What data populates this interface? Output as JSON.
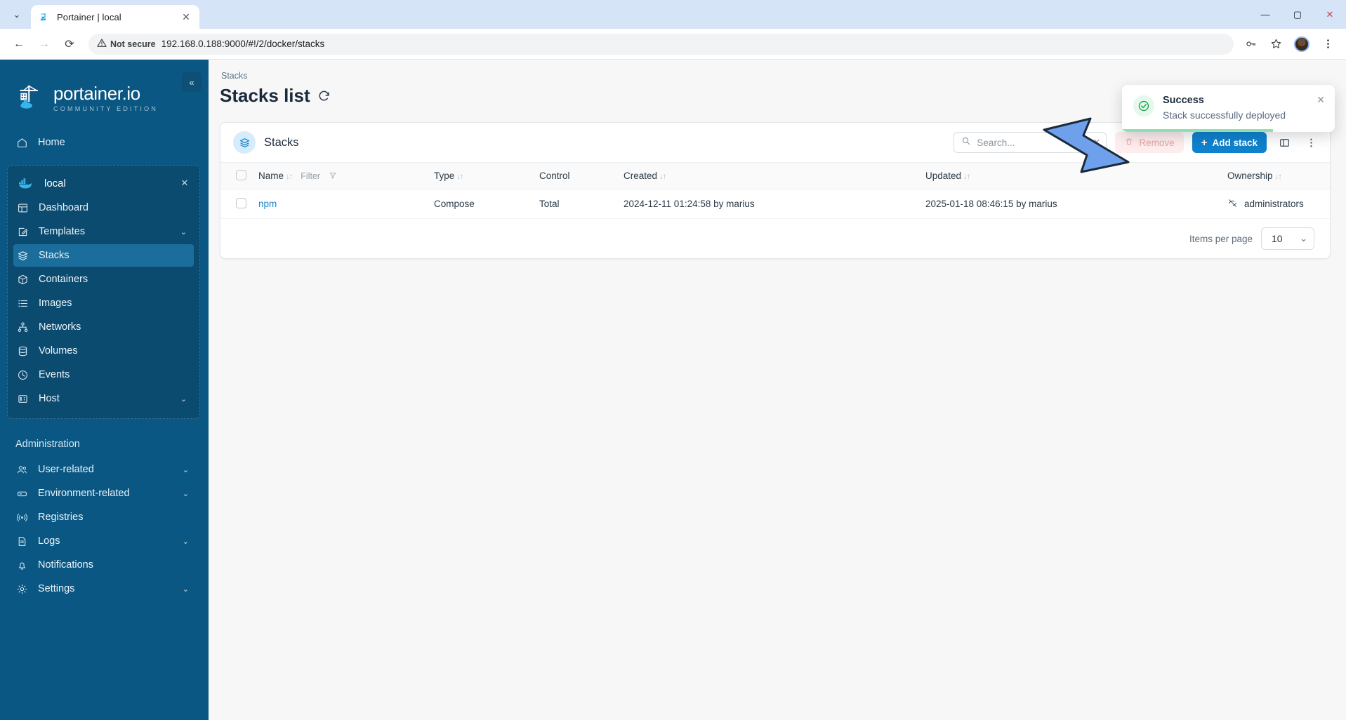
{
  "browser": {
    "tab_title": "Portainer | local",
    "tab_close": "✕",
    "tab_list_arrow": "⌄",
    "favicon": "portainer-favicon",
    "back": "←",
    "forward": "→",
    "reload": "⟳",
    "security_label": "Not secure",
    "url": "192.168.0.188:9000/#!/2/docker/stacks",
    "minimize": "—",
    "maximize": "▢",
    "close": "✕"
  },
  "sidebar": {
    "collapse_icon": "«",
    "logo_title": "portainer.io",
    "logo_subtitle": "COMMUNITY EDITION",
    "home": {
      "label": "Home",
      "icon": "home-icon"
    },
    "environment": {
      "name": "local",
      "close_icon": "✕",
      "items": [
        {
          "label": "Dashboard",
          "icon": "dashboard-icon",
          "chevron": "",
          "active": false
        },
        {
          "label": "Templates",
          "icon": "templates-icon",
          "chevron": "⌄",
          "active": false
        },
        {
          "label": "Stacks",
          "icon": "stacks-icon",
          "chevron": "",
          "active": true
        },
        {
          "label": "Containers",
          "icon": "containers-icon",
          "chevron": "",
          "active": false
        },
        {
          "label": "Images",
          "icon": "images-icon",
          "chevron": "",
          "active": false
        },
        {
          "label": "Networks",
          "icon": "networks-icon",
          "chevron": "",
          "active": false
        },
        {
          "label": "Volumes",
          "icon": "volumes-icon",
          "chevron": "",
          "active": false
        },
        {
          "label": "Events",
          "icon": "events-icon",
          "chevron": "",
          "active": false
        },
        {
          "label": "Host",
          "icon": "host-icon",
          "chevron": "⌄",
          "active": false
        }
      ]
    },
    "administration_title": "Administration",
    "admin_items": [
      {
        "label": "User-related",
        "icon": "users-icon",
        "chevron": "⌄"
      },
      {
        "label": "Environment-related",
        "icon": "environment-icon",
        "chevron": "⌄"
      },
      {
        "label": "Registries",
        "icon": "registries-icon",
        "chevron": ""
      },
      {
        "label": "Logs",
        "icon": "logs-icon",
        "chevron": "⌄"
      },
      {
        "label": "Notifications",
        "icon": "bell-icon",
        "chevron": ""
      },
      {
        "label": "Settings",
        "icon": "gear-icon",
        "chevron": "⌄"
      }
    ]
  },
  "main": {
    "breadcrumb": "Stacks",
    "page_title": "Stacks list",
    "card_title": "Stacks",
    "search_placeholder": "Search...",
    "search_value": "",
    "search_clear": "✕",
    "remove_label": "Remove",
    "add_stack_label": "Add stack",
    "add_stack_plus": "+",
    "columns_icon": "columns-icon",
    "more_icon": "more-vertical-icon",
    "table": {
      "headers": [
        {
          "label": "Name",
          "sortable": true,
          "filter": "Filter"
        },
        {
          "label": "Type",
          "sortable": true
        },
        {
          "label": "Control",
          "sortable": false
        },
        {
          "label": "Created",
          "sortable": true
        },
        {
          "label": "Updated",
          "sortable": true
        },
        {
          "label": "Ownership",
          "sortable": true
        }
      ],
      "sort_glyph": "↓↑",
      "rows": [
        {
          "name": "npm",
          "type": "Compose",
          "control": "Total",
          "created": "2024-12-11 01:24:58 by marius",
          "updated": "2025-01-18 08:46:15 by marius",
          "ownership": "administrators",
          "ownership_icon": "eye-off-icon"
        }
      ]
    },
    "items_per_page_label": "Items per page",
    "items_per_page_value": "10",
    "items_per_page_chevron": "⌄"
  },
  "toast": {
    "title": "Success",
    "message": "Stack successfully deployed",
    "close": "✕",
    "icon": "check-circle-icon",
    "progress_percent": 71
  },
  "colors": {
    "sidebar_bg": "#0a5783",
    "sidebar_active": "#1b6e9c",
    "primary": "#0f82cd",
    "link": "#1a86d0",
    "success": "#16a34a",
    "arrow_fill": "#6fa0ec",
    "danger_soft": "#fdeded"
  }
}
